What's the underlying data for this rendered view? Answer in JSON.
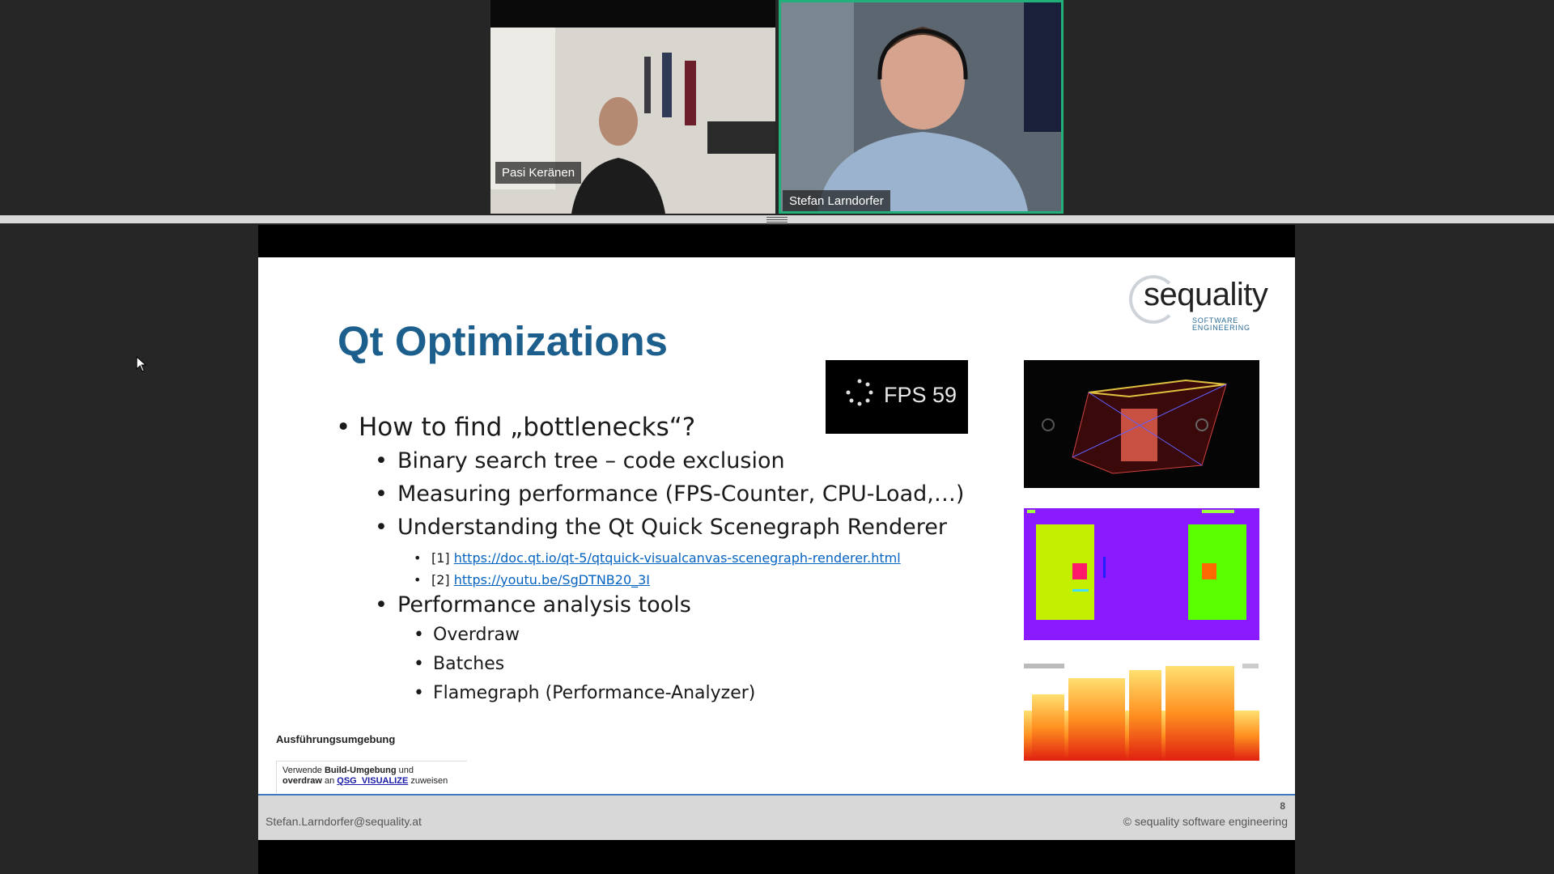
{
  "participants": [
    {
      "name": "Pasi Keränen",
      "active_speaker": false
    },
    {
      "name": "Stefan Larndorfer",
      "active_speaker": true
    }
  ],
  "colors": {
    "active_speaker_border": "#22b07a",
    "title_blue": "#1c5f8c",
    "link_blue": "#0563c1",
    "footer_rule": "#3d78c0"
  },
  "slide": {
    "logo": {
      "text": "sequality",
      "sub_line1": "SOFTWARE",
      "sub_line2": "ENGINEERING"
    },
    "title": "Qt Optimizations",
    "bullets": {
      "main": "How to find „bottlenecks“?",
      "sub1": "Binary search tree – code exclusion",
      "sub2": "Measuring performance (FPS-Counter, CPU-Load,…)",
      "sub3": "Understanding the Qt Quick Scenegraph Renderer",
      "ref1_prefix": "[1]",
      "ref1_link": "https://doc.qt.io/qt-5/qtquick-visualcanvas-scenegraph-renderer.html",
      "ref2_prefix": "[2]",
      "ref2_link": "https://youtu.be/SgDTNB20_3I",
      "sub4": "Performance analysis tools",
      "tool1": "Overdraw",
      "tool2": "Batches",
      "tool3": "Flamegraph (Performance-Analyzer)"
    },
    "fps_label": "FPS 59",
    "inset": {
      "heading": "Ausführungsumgebung",
      "line1_a": "Verwende ",
      "line1_b": "Build-Umgebung",
      "line1_c": " und",
      "line2_a": "overdraw",
      "line2_b": " an ",
      "line2_link": "QSG_VISUALIZE",
      "line2_c": " zuweisen"
    },
    "footer": {
      "email": "Stefan.Larndorfer@sequality.at",
      "copyright": "© sequality software engineering",
      "page": "8"
    }
  }
}
